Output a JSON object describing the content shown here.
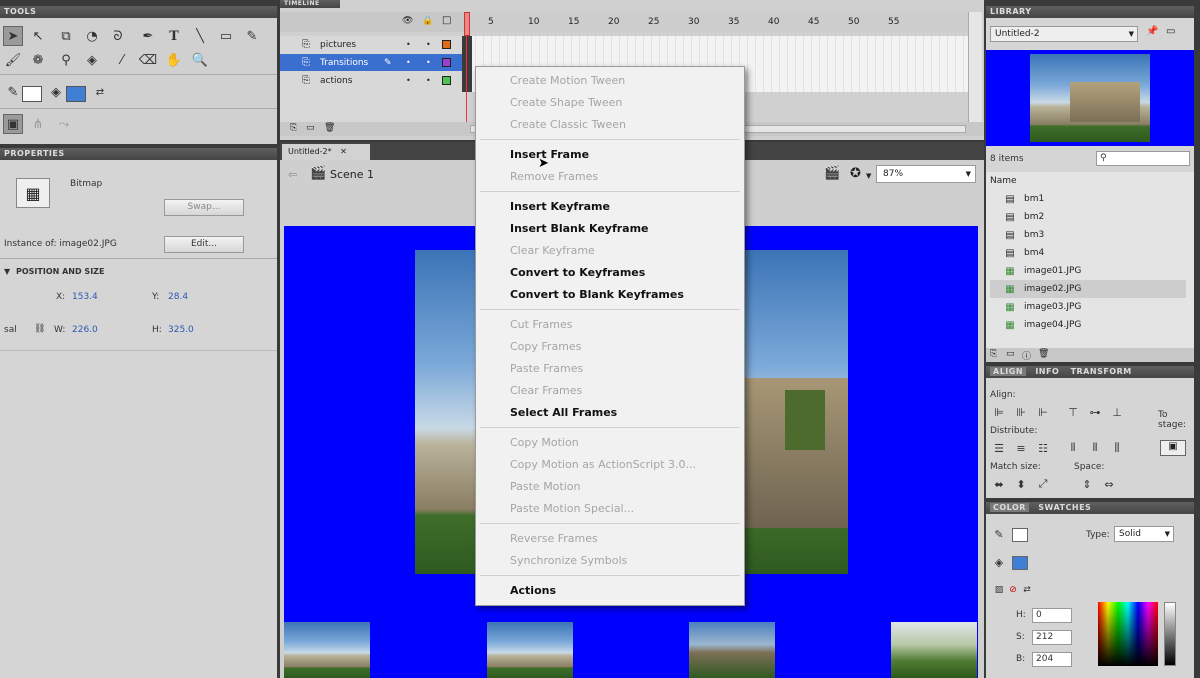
{
  "tools": {
    "title": "TOOLS",
    "items": [
      "selection",
      "subselection",
      "free-transform",
      "3d-rotation",
      "lasso",
      "pen",
      "text",
      "line",
      "rectangle",
      "pencil",
      "brush",
      "deco",
      "bone",
      "paint-bucket",
      "eyedropper",
      "eraser",
      "hand",
      "zoom"
    ]
  },
  "properties": {
    "title": "PROPERTIES",
    "symbol_type": "Bitmap",
    "swap_label": "Swap...",
    "instance_label": "Instance of: image02.JPG",
    "edit_label": "Edit...",
    "section_label": "POSITION AND SIZE",
    "x_label": "X:",
    "x_value": "153.4",
    "y_label": "Y:",
    "y_value": "28.4",
    "w_label": "W:",
    "w_value": "226.0",
    "h_label": "H:",
    "h_value": "325.0",
    "side_label": "sal"
  },
  "timeline": {
    "title": "TIMELINE",
    "frame_numbers": [
      "5",
      "10",
      "15",
      "20",
      "25",
      "30",
      "35",
      "40",
      "45",
      "50",
      "55"
    ],
    "layers": [
      {
        "name": "pictures",
        "color": "#e06a1a"
      },
      {
        "name": "Transitions",
        "color": "#9b3fd0"
      },
      {
        "name": "actions",
        "color": "#4fc24f"
      }
    ]
  },
  "document": {
    "tab": "Untitled-2*",
    "scene": "Scene 1",
    "zoom": "87%",
    "stage_color": "#0000ff"
  },
  "context_menu": {
    "items": [
      {
        "label": "Create Motion Tween",
        "enabled": false
      },
      {
        "label": "Create Shape Tween",
        "enabled": false
      },
      {
        "label": "Create Classic Tween",
        "enabled": false
      },
      {
        "label": "Insert Frame",
        "enabled": true
      },
      {
        "label": "Remove Frames",
        "enabled": false
      },
      {
        "label": "Insert Keyframe",
        "enabled": true
      },
      {
        "label": "Insert Blank Keyframe",
        "enabled": true
      },
      {
        "label": "Clear Keyframe",
        "enabled": false
      },
      {
        "label": "Convert to Keyframes",
        "enabled": true
      },
      {
        "label": "Convert to Blank Keyframes",
        "enabled": true
      },
      {
        "label": "Cut Frames",
        "enabled": false
      },
      {
        "label": "Copy Frames",
        "enabled": false
      },
      {
        "label": "Paste Frames",
        "enabled": false
      },
      {
        "label": "Clear Frames",
        "enabled": false
      },
      {
        "label": "Select All Frames",
        "enabled": true
      },
      {
        "label": "Copy Motion",
        "enabled": false
      },
      {
        "label": "Copy Motion as ActionScript 3.0...",
        "enabled": false
      },
      {
        "label": "Paste Motion",
        "enabled": false
      },
      {
        "label": "Paste Motion Special...",
        "enabled": false
      },
      {
        "label": "Reverse Frames",
        "enabled": false
      },
      {
        "label": "Synchronize Symbols",
        "enabled": false
      },
      {
        "label": "Actions",
        "enabled": true
      }
    ]
  },
  "library": {
    "title": "LIBRARY",
    "document": "Untitled-2",
    "count": "8 items",
    "name_header": "Name",
    "items": [
      {
        "name": "bm1",
        "type": "button"
      },
      {
        "name": "bm2",
        "type": "button"
      },
      {
        "name": "bm3",
        "type": "button"
      },
      {
        "name": "bm4",
        "type": "button"
      },
      {
        "name": "image01.JPG",
        "type": "bitmap"
      },
      {
        "name": "image02.JPG",
        "type": "bitmap"
      },
      {
        "name": "image03.JPG",
        "type": "bitmap"
      },
      {
        "name": "image04.JPG",
        "type": "bitmap"
      }
    ]
  },
  "align": {
    "tabs": [
      "ALIGN",
      "INFO",
      "TRANSFORM"
    ],
    "align_label": "Align:",
    "distribute_label": "Distribute:",
    "match_label": "Match size:",
    "space_label": "Space:",
    "to_stage_label": "To stage:"
  },
  "color": {
    "tabs": [
      "COLOR",
      "SWATCHES"
    ],
    "type_label": "Type:",
    "type_value": "Solid",
    "h_value": "0",
    "s_value": "212",
    "b_value": "204"
  }
}
